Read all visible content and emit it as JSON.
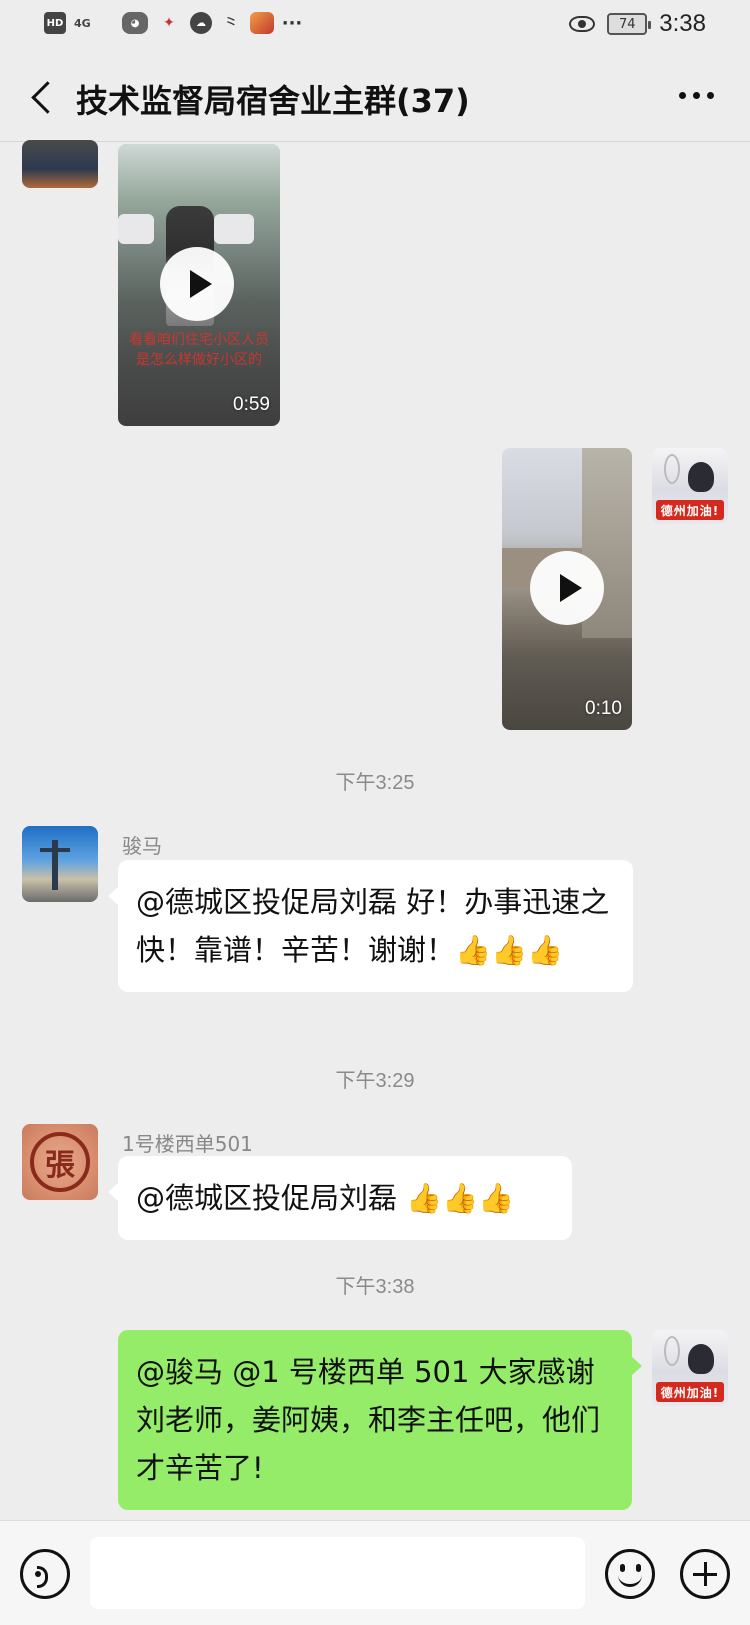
{
  "status_bar": {
    "hd": "HD",
    "network": "4G",
    "battery": "74",
    "time": "3:38",
    "more": "···"
  },
  "header": {
    "title": "技术监督局宿舍业主群(37)",
    "back_icon": "chevron-left-icon",
    "more_icon": "ellipsis-icon"
  },
  "messages": {
    "video1": {
      "duration": "0:59",
      "overlay_text": "看看咱们住宅小区人员 是怎么样做好小区的"
    },
    "video2": {
      "duration": "0:10"
    },
    "my_avatar_tag": "德州加油!",
    "ts1": "下午3:25",
    "msg1": {
      "sender": "骏马",
      "text": "@德城区投促局刘磊  好！办事迅速之快！靠谱！辛苦！谢谢！👍👍👍"
    },
    "ts2": "下午3:29",
    "msg2": {
      "sender": "1号楼西单501",
      "text": "@德城区投促局刘磊  👍👍👍",
      "avatar_char": "張"
    },
    "ts3": "下午3:38",
    "msg3": {
      "text": "@骏马  @1 号楼西单 501  大家感谢刘老师，姜阿姨，和李主任吧，他们才辛苦了!"
    }
  },
  "input_bar": {
    "voice_icon": "voice-icon",
    "input_value": "",
    "emoji_icon": "emoji-icon",
    "plus_icon": "plus-icon"
  },
  "colors": {
    "background": "#ededed",
    "bubble_self": "#95ec69",
    "bubble_other": "#ffffff"
  }
}
